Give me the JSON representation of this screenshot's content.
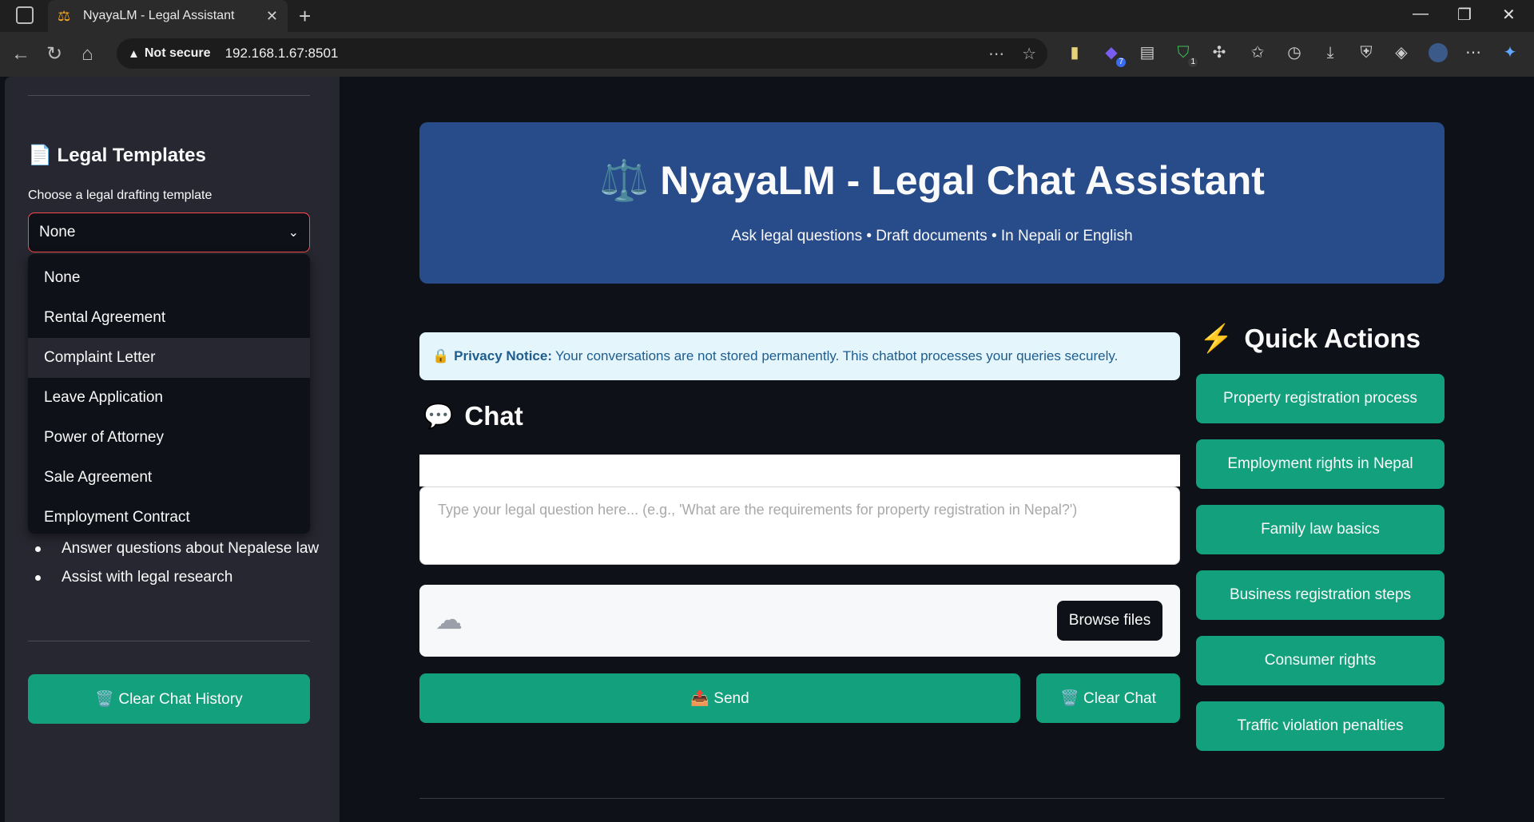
{
  "browser": {
    "tab_title": "NyayaLM - Legal Assistant",
    "security_label": "Not secure",
    "url": "192.168.1.67:8501",
    "ext_badge_1": "7",
    "ext_badge_2": "1"
  },
  "sidebar": {
    "templates_title": "📄 Legal Templates",
    "templates_label": "Choose a legal drafting template",
    "selected_template": "None",
    "template_options": [
      "None",
      "Rental Agreement",
      "Complaint Letter",
      "Leave Application",
      "Power of Attorney",
      "Sale Agreement",
      "Employment Contract"
    ],
    "capabilities": [
      "Answer questions about Nepalese law",
      "Assist with legal research"
    ],
    "clear_history_label": "🗑️ Clear Chat History"
  },
  "main": {
    "hero_title": "⚖️ NyayaLM - Legal Chat Assistant",
    "hero_subtitle": "Ask legal questions • Draft documents • In Nepali or English",
    "privacy_icon": "🔒",
    "privacy_label": "Privacy Notice:",
    "privacy_text": "Your conversations are not stored permanently. This chatbot processes your queries securely.",
    "chat_title": "Chat",
    "chat_icon": "💬",
    "input_placeholder": "Type your legal question here... (e.g., 'What are the requirements for property registration in Nepal?')",
    "browse_label": "Browse files",
    "send_label": "📤 Send",
    "clear_chat_label": "🗑️ Clear Chat"
  },
  "quick_actions": {
    "title": "Quick Actions",
    "items": [
      "Property registration process",
      "Employment rights in Nepal",
      "Family law basics",
      "Business registration steps",
      "Consumer rights",
      "Traffic violation penalties"
    ]
  },
  "colors": {
    "accent_green": "#13a07d",
    "hero_blue": "#284b8a",
    "select_border": "#ff4b4b"
  }
}
